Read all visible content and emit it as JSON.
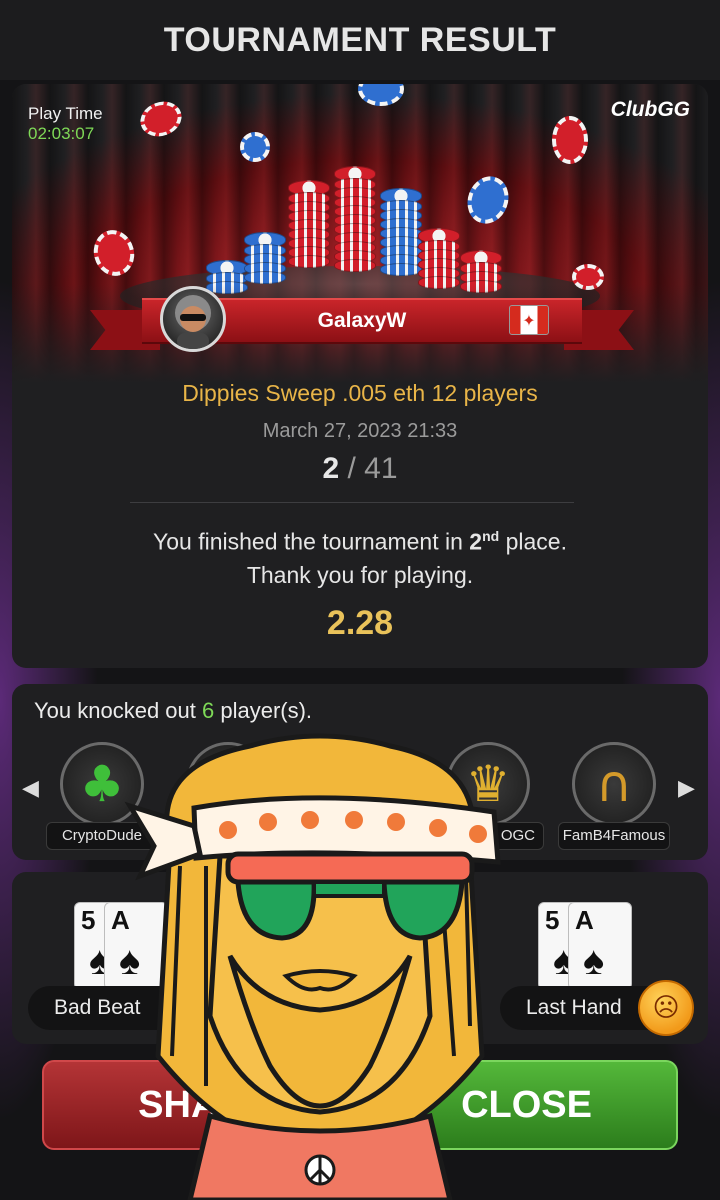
{
  "header": {
    "title": "TOURNAMENT RESULT"
  },
  "banner": {
    "play_time_label": "Play Time",
    "play_time_value": "02:03:07",
    "brand": "ClubGG",
    "player_name": "GalaxyW",
    "flag_icon": "canada-flag-icon"
  },
  "result": {
    "tournament_name": "Dippies Sweep .005 eth 12 players",
    "date": "March 27, 2023 21:33",
    "place": "2",
    "separator": "/",
    "total_players": "41",
    "message_line1_prefix": "You finished the tournament in ",
    "message_place": "2",
    "message_place_suffix": "nd",
    "message_line1_suffix": " place.",
    "message_line2": "Thank you for playing.",
    "prize": "2.28"
  },
  "knockouts": {
    "title_prefix": "You knocked out ",
    "count": "6",
    "title_suffix": " player(s).",
    "players": [
      {
        "name": "CryptoDude",
        "icon": "clover-icon"
      },
      {
        "name": "",
        "icon": "avatar-icon"
      },
      {
        "name": "",
        "icon": "avatar-icon"
      },
      {
        "name": "OGC",
        "icon": "trophy-icon"
      },
      {
        "name": "FamB4Famous",
        "icon": "horseshoe-icon"
      }
    ]
  },
  "hands": {
    "bad_beat_label": "Bad Beat",
    "last_hand_label": "Last Hand",
    "card_rank_1": "5",
    "card_rank_2": "A"
  },
  "buttons": {
    "share": "SHAR",
    "close": "CLOSE"
  },
  "colors": {
    "accent_gold": "#e9b548",
    "green": "#7ed957",
    "share_red": "#b43436",
    "close_green": "#54b83a"
  }
}
